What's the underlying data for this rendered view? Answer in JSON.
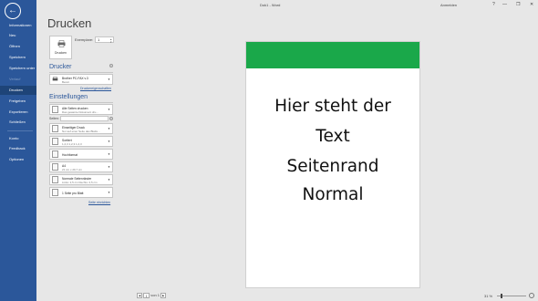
{
  "window": {
    "title": "Dok1  -  Word",
    "signin": "Anmelden",
    "help": "?",
    "minimize": "—",
    "maximize": "❐",
    "close": "✕"
  },
  "sidebar": {
    "back": "←",
    "items_top": [
      {
        "label": "Informationen",
        "state": "normal"
      },
      {
        "label": "Neu",
        "state": "normal"
      },
      {
        "label": "Öffnen",
        "state": "normal"
      },
      {
        "label": "Speichern",
        "state": "normal"
      },
      {
        "label": "Speichern unter",
        "state": "normal"
      },
      {
        "label": "Verlauf",
        "state": "disabled"
      },
      {
        "label": "Drucken",
        "state": "active"
      },
      {
        "label": "Freigeben",
        "state": "normal"
      },
      {
        "label": "Exportieren",
        "state": "normal"
      },
      {
        "label": "Schließen",
        "state": "normal"
      }
    ],
    "items_bottom": [
      {
        "label": "Konto"
      },
      {
        "label": "Feedback"
      },
      {
        "label": "Optionen"
      }
    ]
  },
  "main": {
    "title": "Drucken",
    "print_button": "Drucken",
    "copies_label": "Exemplare:",
    "copies_value": "1",
    "printer_heading": "Drucker",
    "printer_name": "Brother PC-FAX v.3",
    "printer_status": "Bereit",
    "printer_properties_link": "Druckereigenschaften",
    "settings_heading": "Einstellungen",
    "pages_label": "Seiten:",
    "page_setup_link": "Seite einrichten",
    "settings": [
      {
        "key": "range",
        "line1": "Alle Seiten drucken",
        "line2": "Das gesamte Dokument dru..."
      },
      {
        "key": "sides",
        "line1": "Einseitiger Druck",
        "line2": "Nur auf einer Seite des Blatts..."
      },
      {
        "key": "collate",
        "line1": "Sortiert",
        "line2": "1,2,3    1,2,3    1,2,3"
      },
      {
        "key": "orientation",
        "line1": "Hochformat",
        "line2": ""
      },
      {
        "key": "paper",
        "line1": "A4",
        "line2": "21 cm x 29,7 cm"
      },
      {
        "key": "margins",
        "line1": "Normale Seitenränder",
        "line2": "Links: 2,5 cm    Rechts: 2,5 cm"
      },
      {
        "key": "pages_per_sheet",
        "line1": "1 Seite pro Blatt",
        "line2": ""
      }
    ]
  },
  "preview": {
    "band_color": "#1aa84a",
    "lines": [
      "Hier steht der",
      "Text",
      "Seitenrand",
      "Normal"
    ]
  },
  "footer": {
    "page_prev": "◀",
    "page_current": "1",
    "page_of": "von 1",
    "page_next": "▶",
    "zoom": "31 %",
    "zoom_level": 0.31
  },
  "colors": {
    "accent": "#2b579a",
    "active_nav": "#1e4478"
  }
}
